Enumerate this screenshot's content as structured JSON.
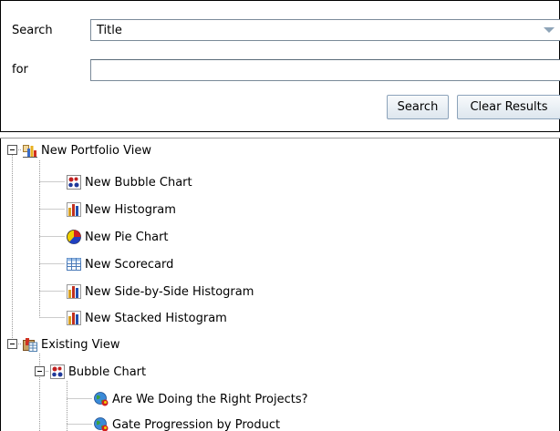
{
  "search": {
    "search_label": "Search",
    "search_field_value": "Title",
    "for_label": "for",
    "for_value": "",
    "search_button": "Search",
    "clear_button": "Clear Results"
  },
  "tree": {
    "portfolio": {
      "label": "New Portfolio View",
      "icon": "portfolio-view-icon",
      "children": [
        {
          "label": "New Bubble Chart",
          "icon": "bubble-chart-icon"
        },
        {
          "label": "New Histogram",
          "icon": "histogram-icon"
        },
        {
          "label": "New Pie Chart",
          "icon": "pie-chart-icon"
        },
        {
          "label": "New Scorecard",
          "icon": "scorecard-icon"
        },
        {
          "label": "New Side-by-Side Histogram",
          "icon": "histogram-icon"
        },
        {
          "label": "New Stacked Histogram",
          "icon": "histogram-icon"
        }
      ]
    },
    "existing": {
      "label": "Existing View",
      "icon": "existing-view-icon",
      "bubble_chart": {
        "label": "Bubble Chart",
        "icon": "bubble-chart-icon",
        "children": [
          {
            "label": "Are We Doing the Right Projects?",
            "icon": "globe-view-icon"
          },
          {
            "label": "Gate Progression by Product",
            "icon": "globe-view-icon"
          }
        ]
      }
    }
  }
}
